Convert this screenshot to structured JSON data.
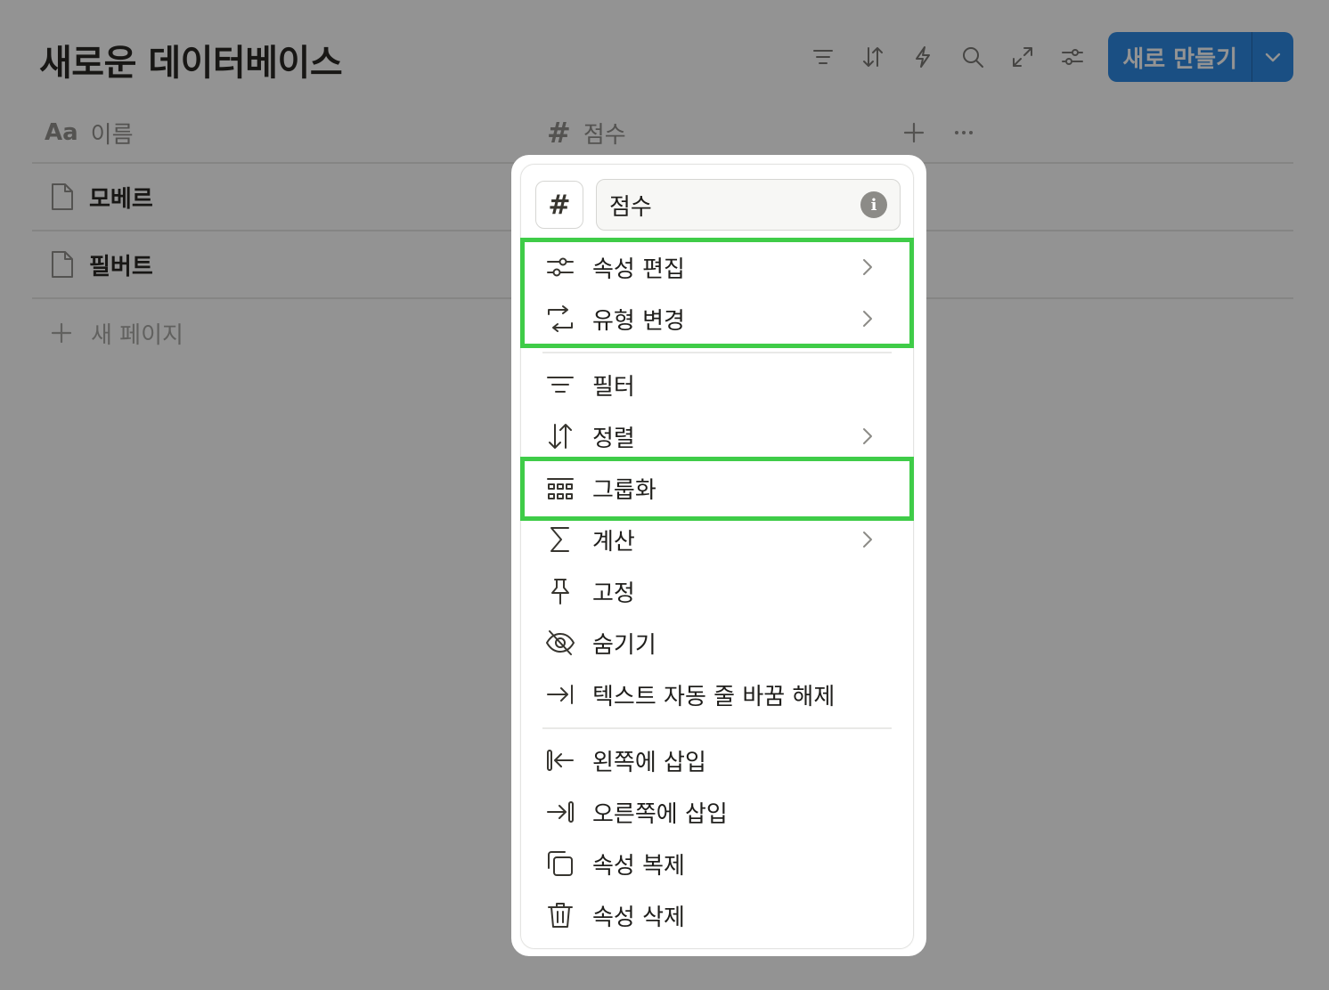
{
  "page": {
    "title": "새로운 데이터베이스",
    "new_button_label": "새로 만들기",
    "toolbar_icons": [
      "filter-icon",
      "sort-icon",
      "automation-bolt-icon",
      "search-icon",
      "expand-icon",
      "settings-sliders-icon"
    ]
  },
  "table": {
    "columns": [
      {
        "icon": "Aa",
        "label": "이름"
      },
      {
        "icon": "#",
        "label": "점수"
      }
    ],
    "rows": [
      {
        "name": "모베르"
      },
      {
        "name": "필버트"
      }
    ],
    "new_page_label": "새 페이지"
  },
  "menu": {
    "type_icon": "#",
    "property_name": "점수",
    "items": [
      {
        "icon": "sliders-icon",
        "label": "속성 편집",
        "submenu": true
      },
      {
        "icon": "convert-icon",
        "label": "유형 변경",
        "submenu": true
      },
      {
        "icon": "filter-icon",
        "label": "필터",
        "submenu": false
      },
      {
        "icon": "sort-icon",
        "label": "정렬",
        "submenu": true
      },
      {
        "icon": "group-icon",
        "label": "그룹화",
        "submenu": false
      },
      {
        "icon": "sigma-icon",
        "label": "계산",
        "submenu": true
      },
      {
        "icon": "pin-icon",
        "label": "고정",
        "submenu": false
      },
      {
        "icon": "eye-off-icon",
        "label": "숨기기",
        "submenu": false
      },
      {
        "icon": "wrap-icon",
        "label": "텍스트 자동 줄 바꿈 해제",
        "submenu": false
      },
      {
        "icon": "insert-left-icon",
        "label": "왼쪽에 삽입",
        "submenu": false
      },
      {
        "icon": "insert-right-icon",
        "label": "오른쪽에 삽입",
        "submenu": false
      },
      {
        "icon": "duplicate-icon",
        "label": "속성 복제",
        "submenu": false
      },
      {
        "icon": "trash-icon",
        "label": "속성 삭제",
        "submenu": false
      }
    ]
  },
  "colors": {
    "accent": "#2383e2",
    "highlight": "#3fcc48",
    "overlay": "rgba(15,15,15,0.45)"
  }
}
